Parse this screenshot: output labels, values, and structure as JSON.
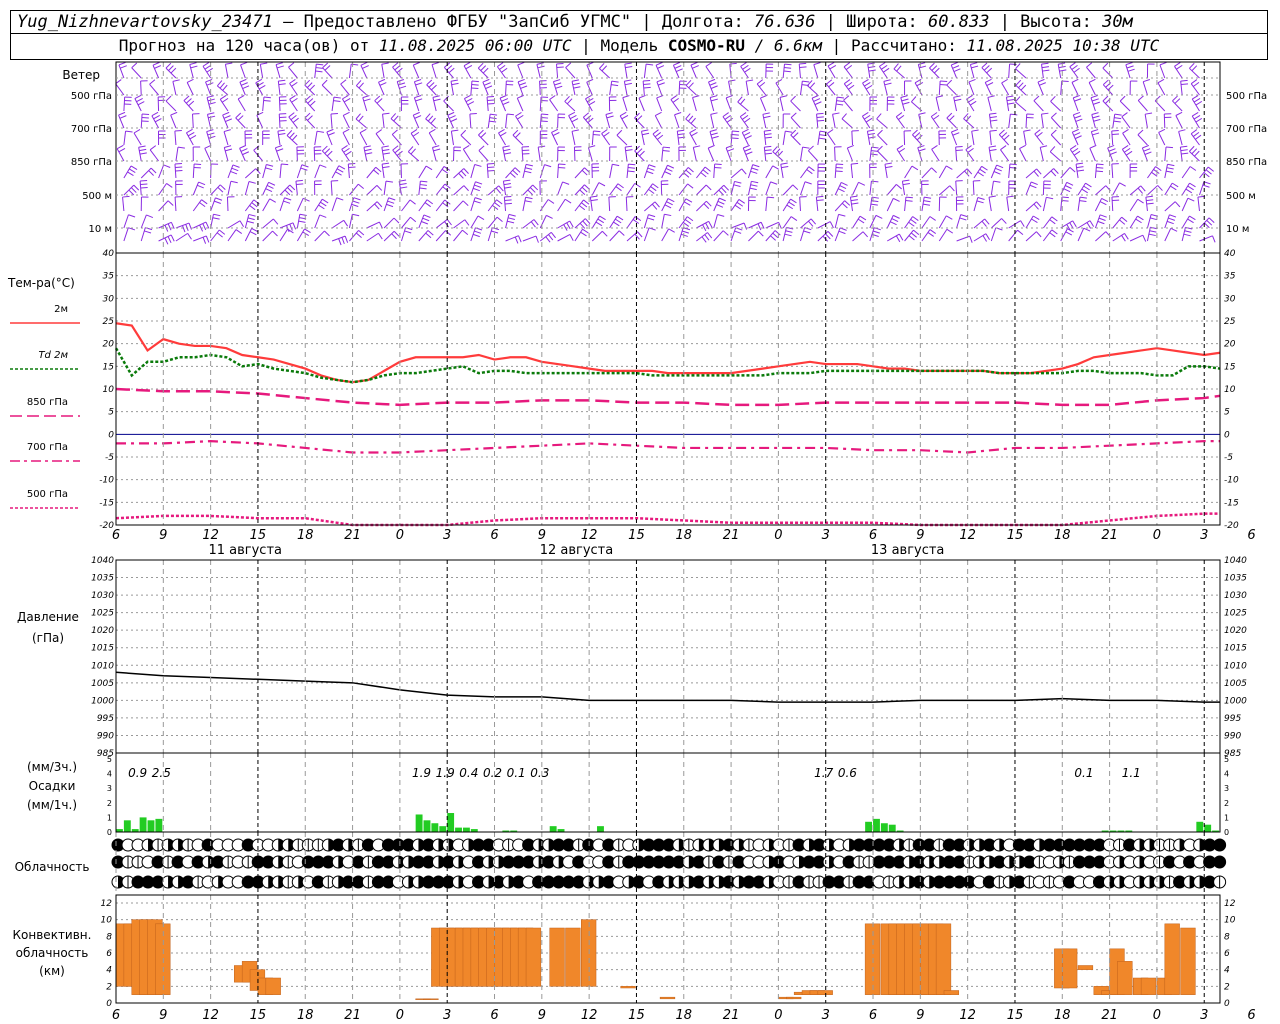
{
  "header": {
    "station": "Yug_Nizhnevartovsky_23471",
    "provider": "– Предоставлено ФГБУ \"ЗапСиб УГМС\"",
    "lon_label": "Долгота:",
    "lon": "76.636",
    "lat_label": "Широта:",
    "lat": "60.833",
    "alt_label": "Высота:",
    "alt": "30м",
    "forecast_label": "Прогноз на 120 часа(ов) от",
    "forecast_from": "11.08.2025 06:00 UTC",
    "model_label": "Модель",
    "model": "COSMO-RU",
    "model_res": "/ 6.6км",
    "computed_label": "Рассчитано:",
    "computed": "11.08.2025 10:38 UTC"
  },
  "wind_panel": {
    "title": "Ветер",
    "levels": [
      "500 гПа",
      "700 гПа",
      "850 гПа",
      "500 м",
      "10  м"
    ],
    "barb_color": "#8a2be2"
  },
  "temp_panel": {
    "title": "Тем-ра(°C)",
    "legend": [
      {
        "label": "2м",
        "color": "#ff3b3b",
        "style": "solid"
      },
      {
        "label": "Td  2м",
        "color": "#0a7a0a",
        "style": "dotted"
      },
      {
        "label": "850 гПа",
        "color": "#e6197d",
        "style": "dashed"
      },
      {
        "label": "700 гПа",
        "color": "#e6197d",
        "style": "dashdot"
      },
      {
        "label": "500 гПа",
        "color": "#e6197d",
        "style": "dotted"
      }
    ],
    "y_ticks": [
      "40",
      "35",
      "30",
      "25",
      "20",
      "15",
      "10",
      "5",
      "0",
      "-5",
      "-10",
      "-15",
      "-20"
    ],
    "x_ticks": [
      "6",
      "9",
      "12",
      "15",
      "18",
      "21",
      "0",
      "3",
      "6",
      "9",
      "12",
      "15",
      "18",
      "21",
      "0",
      "3",
      "6",
      "9",
      "12",
      "15",
      "18",
      "21",
      "0",
      "3",
      "6",
      "9",
      "12"
    ],
    "days": [
      "11 августа",
      "12 августа",
      "13 августа"
    ]
  },
  "pressure_panel": {
    "title": "Давление",
    "unit": "(гПа)",
    "y_ticks": [
      "1040",
      "1035",
      "1030",
      "1025",
      "1020",
      "1015",
      "1010",
      "1005",
      "1000",
      "995",
      "990",
      "985"
    ]
  },
  "precip_panel": {
    "unit3": "(мм/3ч.)",
    "title": "Осадки",
    "unit1": "(мм/1ч.)",
    "y_ticks": [
      "5",
      "4",
      "3",
      "2",
      "1",
      "0"
    ],
    "y_ticks_small": [
      "5",
      "4",
      "3",
      "2",
      "1",
      "0"
    ],
    "totals": [
      {
        "hour": 9,
        "text": "0.9"
      },
      {
        "hour": 12,
        "text": "2.5"
      },
      {
        "hour": 45,
        "text": "1.9"
      },
      {
        "hour": 48,
        "text": "1.9"
      },
      {
        "hour": 51,
        "text": "0.4"
      },
      {
        "hour": 54,
        "text": "0.2"
      },
      {
        "hour": 57,
        "text": "0.1"
      },
      {
        "hour": 60,
        "text": "0.3"
      },
      {
        "hour": 96,
        "text": "1.7"
      },
      {
        "hour": 99,
        "text": "0.6"
      },
      {
        "hour": 129,
        "text": "0.1"
      },
      {
        "hour": 135,
        "text": "1.1"
      }
    ]
  },
  "cloud_panel": {
    "title": "Облачность"
  },
  "conv_panel": {
    "title1": "Конвективн.",
    "title2": "облачность",
    "unit": "(км)",
    "y_ticks": [
      "12",
      "10",
      "8",
      "6",
      "4",
      "2",
      "0"
    ]
  },
  "chart_data": [
    {
      "type": "line",
      "title": "Тем-ра(°C)",
      "x_unit": "hours from 11.08.2025 06:00 UTC",
      "ylim": [
        -20,
        40
      ],
      "series": [
        {
          "name": "2м",
          "x": [
            0,
            2,
            4,
            6,
            8,
            10,
            12,
            14,
            16,
            18,
            20,
            22,
            24,
            26,
            28,
            30,
            32,
            34,
            36,
            38,
            40,
            42,
            44,
            46,
            48,
            50,
            52,
            54,
            56,
            58,
            60,
            62,
            64,
            66,
            68,
            70,
            72,
            74,
            76,
            78,
            80,
            82,
            84,
            86,
            88,
            90,
            92,
            94,
            96,
            98,
            100,
            102,
            104,
            106,
            108,
            110,
            112,
            114,
            116,
            118,
            120,
            122,
            124,
            126,
            128,
            130,
            132,
            134,
            136,
            138,
            140
          ],
          "values": [
            24.5,
            24,
            18.5,
            21,
            20,
            19.5,
            19.5,
            19,
            17.5,
            17,
            16.5,
            15.5,
            14.5,
            13,
            12,
            11.5,
            12,
            14,
            16,
            17,
            17,
            17,
            17,
            17.5,
            16.5,
            17,
            17,
            16,
            15.5,
            15,
            14.5,
            14,
            14,
            14,
            14,
            13.5,
            13.5,
            13.5,
            13.5,
            13.5,
            14,
            14.5,
            15,
            15.5,
            16,
            15.5,
            15.5,
            15.5,
            15,
            14.5,
            14.5,
            14,
            14,
            14,
            14,
            14,
            13.5,
            13.5,
            13.5,
            14,
            14.5,
            15.5,
            17,
            17.5,
            18,
            18.5,
            19,
            18.5,
            18,
            17.5,
            18
          ]
        },
        {
          "name": "Td  2м",
          "x": [
            0,
            2,
            4,
            6,
            8,
            10,
            12,
            14,
            16,
            18,
            20,
            22,
            24,
            26,
            28,
            30,
            32,
            34,
            36,
            38,
            40,
            42,
            44,
            46,
            48,
            50,
            52,
            54,
            56,
            58,
            60,
            62,
            64,
            66,
            68,
            70,
            72,
            74,
            76,
            78,
            80,
            82,
            84,
            86,
            88,
            90,
            92,
            94,
            96,
            98,
            100,
            102,
            104,
            106,
            108,
            110,
            112,
            114,
            116,
            118,
            120,
            122,
            124,
            126,
            128,
            130,
            132,
            134,
            136,
            138,
            140
          ],
          "values": [
            19,
            13,
            16,
            16,
            17,
            17,
            17.5,
            17,
            15,
            15.5,
            14.5,
            14,
            13.5,
            12.5,
            12,
            11.5,
            12,
            13,
            13.5,
            13.5,
            14,
            14.5,
            15,
            13.5,
            14,
            14,
            13.5,
            13.5,
            13.5,
            13.5,
            13.5,
            13.5,
            13.5,
            13.5,
            13,
            13,
            13,
            13,
            13,
            13,
            13,
            13,
            13.5,
            13.5,
            13.5,
            14,
            14,
            14,
            14,
            14,
            14,
            14,
            14,
            14,
            14,
            14,
            13.5,
            13.5,
            13.5,
            13.5,
            13.5,
            14,
            14,
            13.5,
            13.5,
            13.5,
            13,
            13,
            15,
            15,
            14.5
          ]
        },
        {
          "name": "850 гПа",
          "x": [
            0,
            6,
            12,
            18,
            24,
            30,
            36,
            42,
            48,
            54,
            60,
            66,
            72,
            78,
            84,
            90,
            96,
            102,
            108,
            114,
            120,
            126,
            132,
            138,
            140
          ],
          "values": [
            10,
            9.5,
            9.5,
            9,
            8,
            7,
            6.5,
            7,
            7,
            7.5,
            7.5,
            7,
            7,
            6.5,
            6.5,
            7,
            7,
            7,
            7,
            7,
            6.5,
            6.5,
            7.5,
            8,
            8.5
          ]
        },
        {
          "name": "700 гПа",
          "x": [
            0,
            6,
            12,
            18,
            24,
            30,
            36,
            42,
            48,
            54,
            60,
            66,
            72,
            78,
            84,
            90,
            96,
            102,
            108,
            114,
            120,
            126,
            132,
            138,
            140
          ],
          "values": [
            -2,
            -2,
            -1.5,
            -2,
            -3,
            -4,
            -4,
            -3.5,
            -3,
            -2.5,
            -2,
            -2.5,
            -3,
            -3,
            -3,
            -3,
            -3.5,
            -3.5,
            -4,
            -3,
            -3,
            -2.5,
            -2,
            -1.5,
            -1.5
          ]
        },
        {
          "name": "500 гПа",
          "x": [
            0,
            6,
            12,
            18,
            24,
            30,
            36,
            42,
            48,
            54,
            60,
            66,
            72,
            78,
            84,
            90,
            96,
            102,
            108,
            114,
            120,
            126,
            132,
            138,
            140
          ],
          "values": [
            -18.5,
            -18,
            -18,
            -18.5,
            -18.5,
            -20,
            -21,
            -20,
            -19,
            -18.5,
            -18.5,
            -18.5,
            -19,
            -19.5,
            -19.5,
            -19.5,
            -19.5,
            -20,
            -20.5,
            -21,
            -20,
            -19,
            -18,
            -17.5,
            -17.5
          ]
        }
      ]
    },
    {
      "type": "line",
      "title": "Давление",
      "x_unit": "hours from 11.08.2025 06:00 UTC",
      "ylim": [
        985,
        1040
      ],
      "series": [
        {
          "name": "",
          "x": [
            0,
            6,
            12,
            18,
            24,
            30,
            36,
            42,
            48,
            54,
            60,
            66,
            72,
            78,
            84,
            90,
            96,
            102,
            108,
            114,
            120,
            126,
            132,
            138,
            140
          ],
          "values": [
            1008,
            1007,
            1006.5,
            1006,
            1005.5,
            1005,
            1003,
            1001.5,
            1001,
            1001,
            1000,
            1000,
            1000,
            1000,
            999.5,
            999.5,
            999.5,
            1000,
            1000,
            1000,
            1000.5,
            1000,
            1000,
            999.5,
            999.5
          ]
        }
      ]
    },
    {
      "type": "bar",
      "title": "Осадки",
      "x_unit": "hours from 11.08.2025 06:00 UTC",
      "ylim": [
        0,
        5
      ],
      "x": [
        1,
        2,
        3,
        4,
        5,
        6,
        39,
        40,
        41,
        42,
        43,
        44,
        45,
        46,
        50,
        51,
        56,
        57,
        62,
        96,
        97,
        98,
        99,
        100,
        126,
        127,
        128,
        129,
        138,
        139,
        140
      ],
      "values": [
        0.2,
        0.8,
        0.2,
        1,
        0.8,
        0.9,
        1.2,
        0.8,
        0.6,
        0.4,
        1.3,
        0.3,
        0.3,
        0.2,
        0.1,
        0.1,
        0.4,
        0.2,
        0.4,
        0.7,
        0.9,
        0.6,
        0.5,
        0.1,
        0.1,
        0.1,
        0.1,
        0.1,
        0.7,
        0.5,
        0.1
      ]
    },
    {
      "type": "bar",
      "title": "Конвективн. облачность",
      "x_unit": "hours from 11.08.2025 06:00 UTC",
      "ylim": [
        0,
        12
      ],
      "x": [
        1,
        2,
        3,
        4,
        5,
        6,
        16,
        17,
        18,
        19,
        20,
        39,
        40,
        41,
        42,
        43,
        44,
        45,
        46,
        47,
        48,
        49,
        50,
        51,
        52,
        53,
        56,
        58,
        60,
        65,
        70,
        85,
        86,
        87,
        88,
        89,
        90,
        96,
        98,
        99,
        100,
        101,
        102,
        103,
        104,
        105,
        106,
        120,
        121,
        123,
        125,
        126,
        127,
        128,
        130,
        131,
        133,
        134,
        136
      ],
      "values_base": [
        2,
        2,
        1,
        1,
        1,
        1,
        2.5,
        2.5,
        1.5,
        1,
        1,
        0.4,
        0.4,
        2,
        2,
        2,
        2,
        2,
        2,
        2,
        2,
        2,
        2,
        2,
        2,
        2,
        2,
        2,
        2,
        1.8,
        0.5,
        0.5,
        0.5,
        1,
        1,
        1,
        1,
        1,
        1,
        1,
        1,
        1,
        1,
        1,
        1,
        1,
        1,
        1.8,
        1.8,
        4,
        1,
        1,
        1,
        1,
        1,
        1,
        1,
        1,
        1
      ],
      "values_top": [
        9.5,
        9.5,
        10,
        10,
        10,
        9.5,
        4.5,
        5,
        4,
        3,
        3,
        0.5,
        0.5,
        9,
        9,
        9,
        9,
        9,
        9,
        9,
        9,
        9,
        9,
        9,
        9,
        9,
        9,
        9,
        10,
        2,
        0.7,
        0.7,
        0.7,
        1.3,
        1.5,
        1.5,
        1.5,
        9.5,
        9.5,
        9.5,
        9.5,
        9.5,
        9.5,
        9.5,
        9.5,
        9.5,
        1.5,
        6.5,
        6.5,
        4.5,
        2,
        1.5,
        6.5,
        5,
        3,
        3,
        3,
        9.5,
        9,
        7
      ]
    }
  ]
}
